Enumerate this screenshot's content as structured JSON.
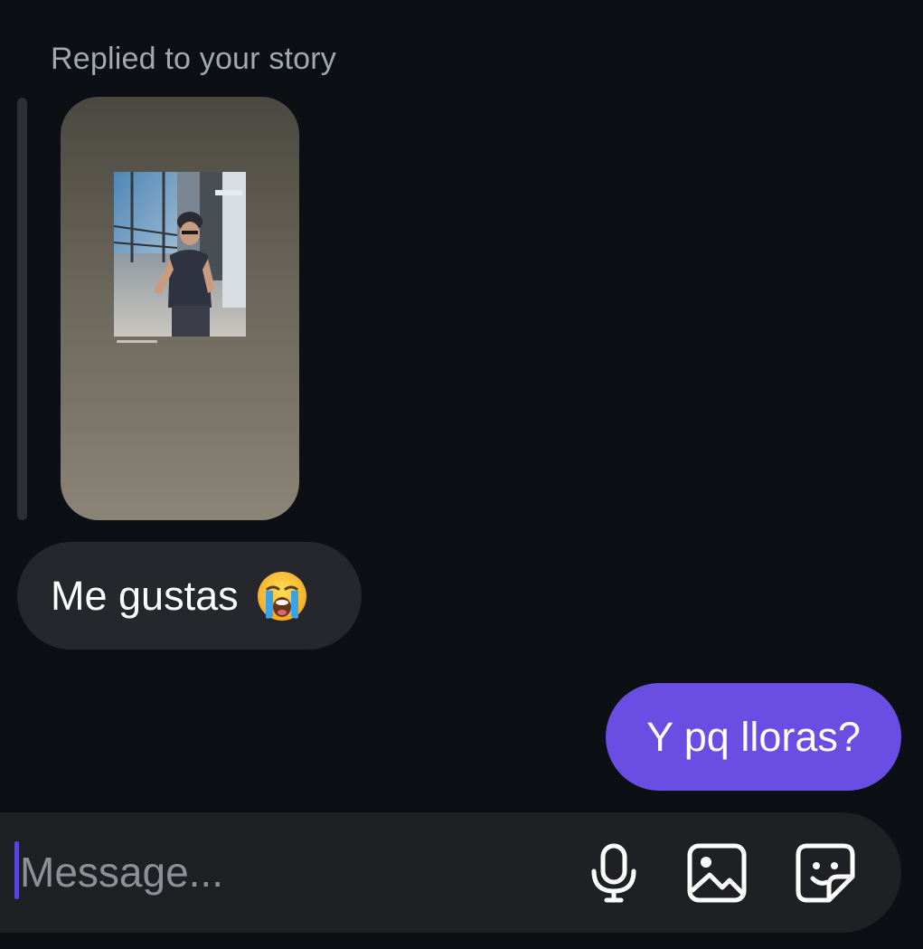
{
  "thread": {
    "reply_label": "Replied to your story",
    "messages": [
      {
        "direction": "incoming",
        "text": "Me gustas",
        "emoji": "loudly-crying-face"
      },
      {
        "direction": "outgoing",
        "text": "Y pq lloras?"
      }
    ]
  },
  "composer": {
    "placeholder": "Message...",
    "value": "",
    "icons": [
      "microphone-icon",
      "image-icon",
      "sticker-icon"
    ]
  },
  "colors": {
    "background": "#0c0f14",
    "incoming_bubble": "#25272d",
    "outgoing_bubble": "#6a4ee3",
    "composer": "#1f2024",
    "muted_text": "#a3a7ae"
  }
}
